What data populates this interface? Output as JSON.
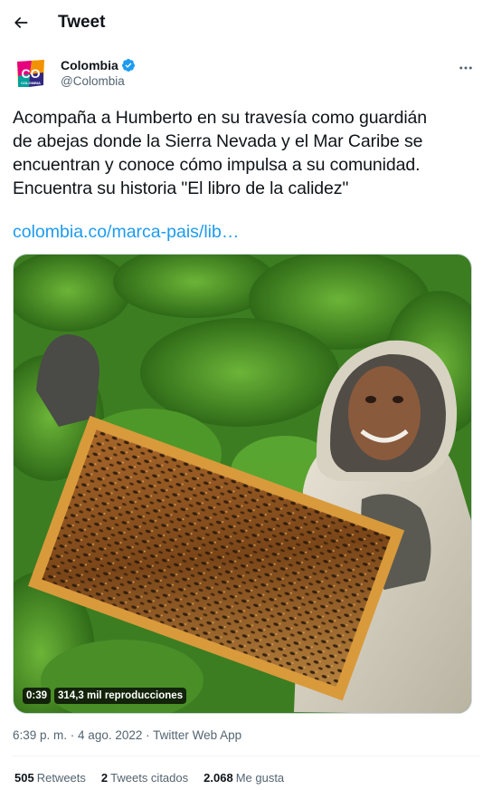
{
  "header": {
    "title": "Tweet"
  },
  "author": {
    "avatar_text": "CO",
    "avatar_subtext": "COLOMBIA",
    "name": "Colombia",
    "handle": "@Colombia",
    "verified": true
  },
  "tweet": {
    "lines": [
      "Acompaña a Humberto en su travesía como guardián",
      "de abejas donde la Sierra Nevada y el Mar Caribe se",
      "encuentran y conoce cómo impulsa a su comunidad.",
      "Encuentra su historia \"El libro de la calidez\""
    ],
    "link": "colombia.co/marca-pais/lib…"
  },
  "media": {
    "duration": "0:39",
    "views": "314,3 mil reproducciones"
  },
  "meta": {
    "time": "6:39 p. m.",
    "separator1": " · ",
    "date": "4 ago. 2022",
    "separator2": " · ",
    "app": "Twitter Web App"
  },
  "stats": {
    "retweets": {
      "count": "505",
      "label": "Retweets"
    },
    "quotes": {
      "count": "2",
      "label": "Tweets citados"
    },
    "likes": {
      "count": "2.068",
      "label": "Me gusta"
    }
  },
  "colors": {
    "link": "#1d9bf0",
    "secondary_text": "#536471",
    "verified": "#1d9bf0"
  }
}
